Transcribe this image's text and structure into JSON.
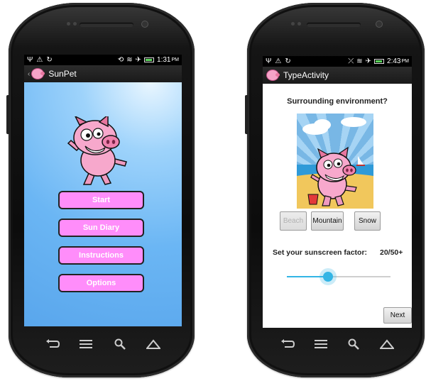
{
  "left_phone": {
    "status": {
      "time": "1:31",
      "ampm": "PM"
    },
    "action_bar": {
      "title": "SunPet"
    },
    "menu": {
      "start_label": "Start",
      "diary_label": "Sun Diary",
      "instructions_label": "Instructions",
      "options_label": "Options"
    }
  },
  "right_phone": {
    "status": {
      "time": "2:43",
      "ampm": "PM"
    },
    "action_bar": {
      "title": "TypeActivity"
    },
    "question": "Surrounding environment?",
    "environment": {
      "beach_label": "Beach",
      "mountain_label": "Mountain",
      "snow_label": "Snow"
    },
    "sunscreen": {
      "label": "Set your sunscreen factor:",
      "value": "20/50+",
      "slider_fraction": 0.4
    },
    "next_label": "Next"
  },
  "colors": {
    "menu_button": "#ff8dfa",
    "slider_accent": "#33b5e5",
    "app_background": "#6bb6f4"
  },
  "icons": [
    "back-key-icon",
    "menu-key-icon",
    "search-key-icon",
    "home-key-icon",
    "usb-icon",
    "wifi-icon",
    "airplane-icon",
    "battery-icon",
    "pig-logo-icon"
  ]
}
